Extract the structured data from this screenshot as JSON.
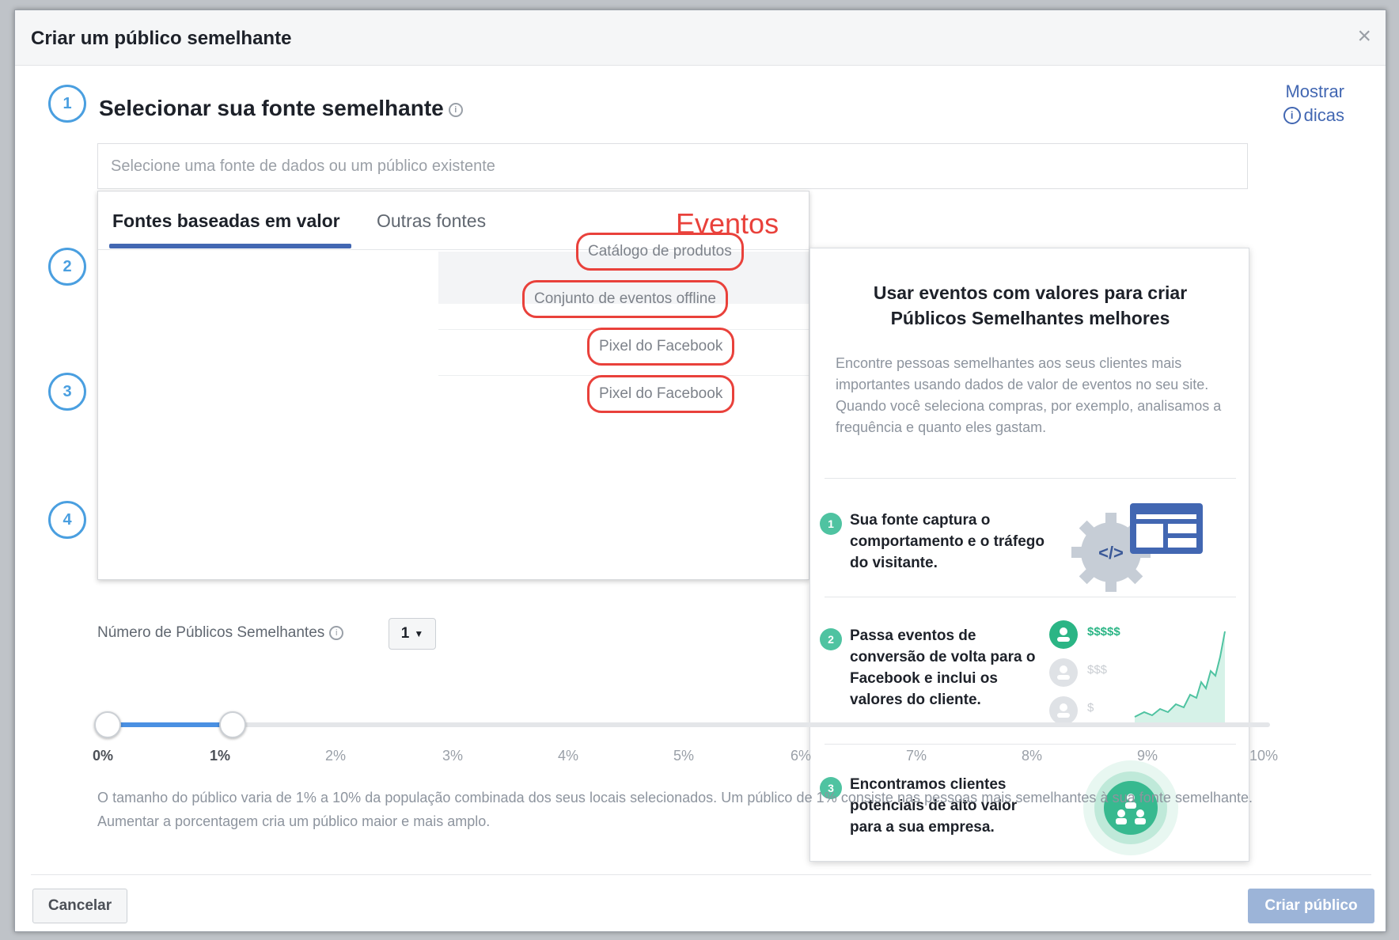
{
  "dialog": {
    "title": "Criar um público semelhante",
    "close_symbol": "×",
    "tips_line1": "Mostrar",
    "tips_line2": "dicas"
  },
  "steps": [
    "1",
    "2",
    "3",
    "4"
  ],
  "section1": {
    "title": "Selecionar sua fonte semelhante",
    "input_placeholder": "Selecione uma fonte de dados ou um público existente"
  },
  "dropdown": {
    "tabs": [
      {
        "label": "Fontes baseadas em valor",
        "active": true
      },
      {
        "label": "Outras fontes",
        "active": false
      }
    ],
    "annotation": "Eventos",
    "options": [
      "Catálogo de produtos",
      "Conjunto de eventos offline",
      "Pixel do Facebook",
      "Pixel do Facebook"
    ]
  },
  "info_panel": {
    "title": "Usar eventos com valores para criar Públicos Semelhantes melhores",
    "description": "Encontre pessoas semelhantes aos seus clientes mais importantes usando dados de valor de eventos no seu site. Quando você seleciona compras, por exemplo, analisamos a frequência e quanto eles gastam.",
    "items": [
      {
        "num": "1",
        "text": "Sua fonte captura o comportamento e o tráfego do visitante."
      },
      {
        "num": "2",
        "text": "Passa eventos de conversão de volta para o Facebook e inclui os valores do cliente."
      },
      {
        "num": "3",
        "text": "Encontramos clientes potenciais de alto valor para a sua empresa."
      }
    ],
    "value_labels": [
      "$$$$$",
      "$$$",
      "$"
    ]
  },
  "audience": {
    "count_label": "Número de Públicos Semelhantes",
    "count_value": "1",
    "slider_range": [
      0,
      1
    ],
    "ticks": [
      "0%",
      "1%",
      "2%",
      "3%",
      "4%",
      "5%",
      "6%",
      "7%",
      "8%",
      "9%",
      "10%"
    ],
    "help_text": "O tamanho do público varia de 1% a 10% da população combinada dos seus locais selecionados. Um público de 1% consiste nas pessoas mais semelhantes à sua fonte semelhante. Aumentar a porcentagem cria um público maior e mais amplo."
  },
  "footer": {
    "cancel_label": "Cancelar",
    "create_label": "Criar público"
  },
  "colors": {
    "accent": "#4267b2",
    "step": "#4a9fe0",
    "annotation": "#e9413b",
    "success": "#4fc3a1",
    "create_disabled": "#9cb4d8"
  }
}
